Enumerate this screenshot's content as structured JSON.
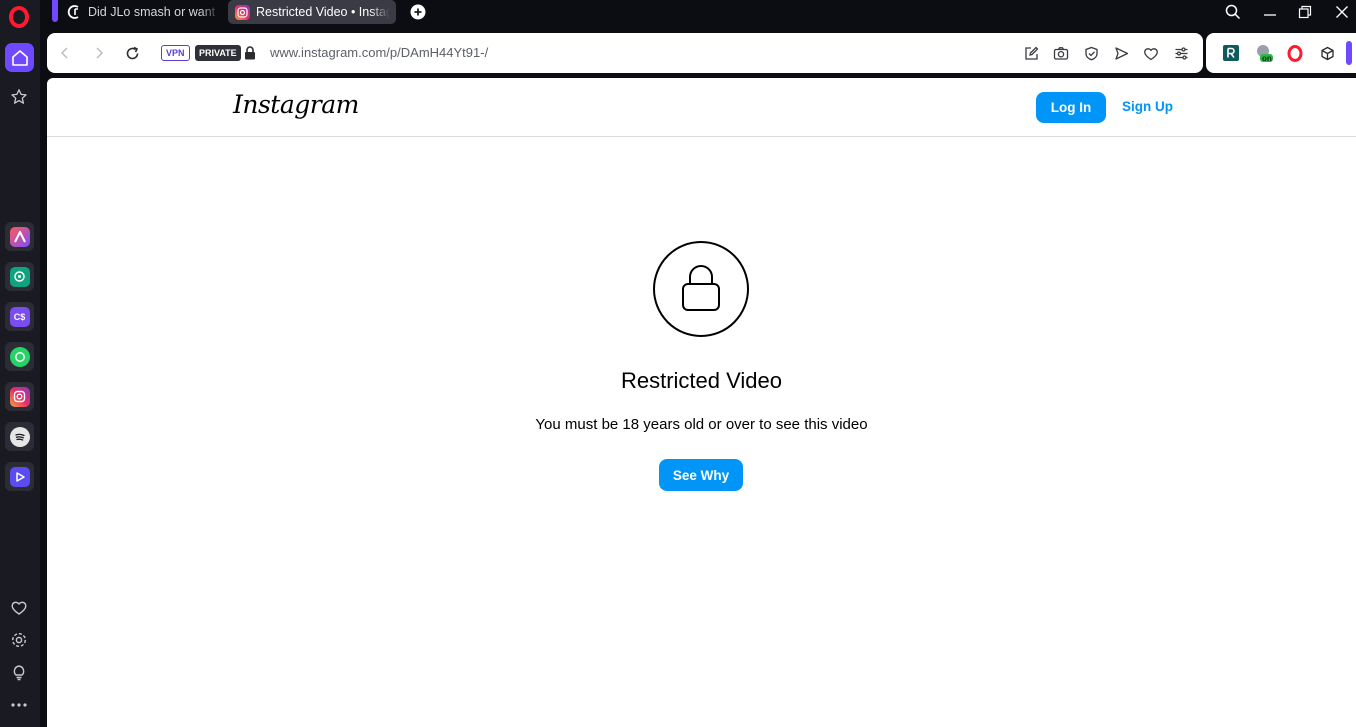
{
  "tabs": [
    {
      "title": "Did JLo smash or want to",
      "active": false
    },
    {
      "title": "Restricted Video • Instagram",
      "active": true
    }
  ],
  "addressbar": {
    "vpn_label": "VPN",
    "private_label": "PRIVATE",
    "url": "www.instagram.com/p/DAmH44Yt91-/"
  },
  "extensions": {
    "badge_on": "on"
  },
  "sidebar": {
    "apps": [
      {
        "name": "aria",
        "color": "#e84a8a"
      },
      {
        "name": "chatgpt",
        "color": "#10a37f"
      },
      {
        "name": "cs",
        "label": "C$",
        "color": "#7a4df0"
      },
      {
        "name": "whatsapp",
        "color": "#25d366"
      },
      {
        "name": "instagram",
        "color": "#e1306c"
      },
      {
        "name": "spotify",
        "color": "#1db954"
      },
      {
        "name": "player",
        "color": "#5b4cf0"
      }
    ]
  },
  "instagram": {
    "logo_text": "Instagram",
    "login_label": "Log In",
    "signup_label": "Sign Up",
    "title": "Restricted Video",
    "message": "You must be 18 years old or over to see this video",
    "see_why_label": "See Why",
    "accent": "#0095f6"
  }
}
